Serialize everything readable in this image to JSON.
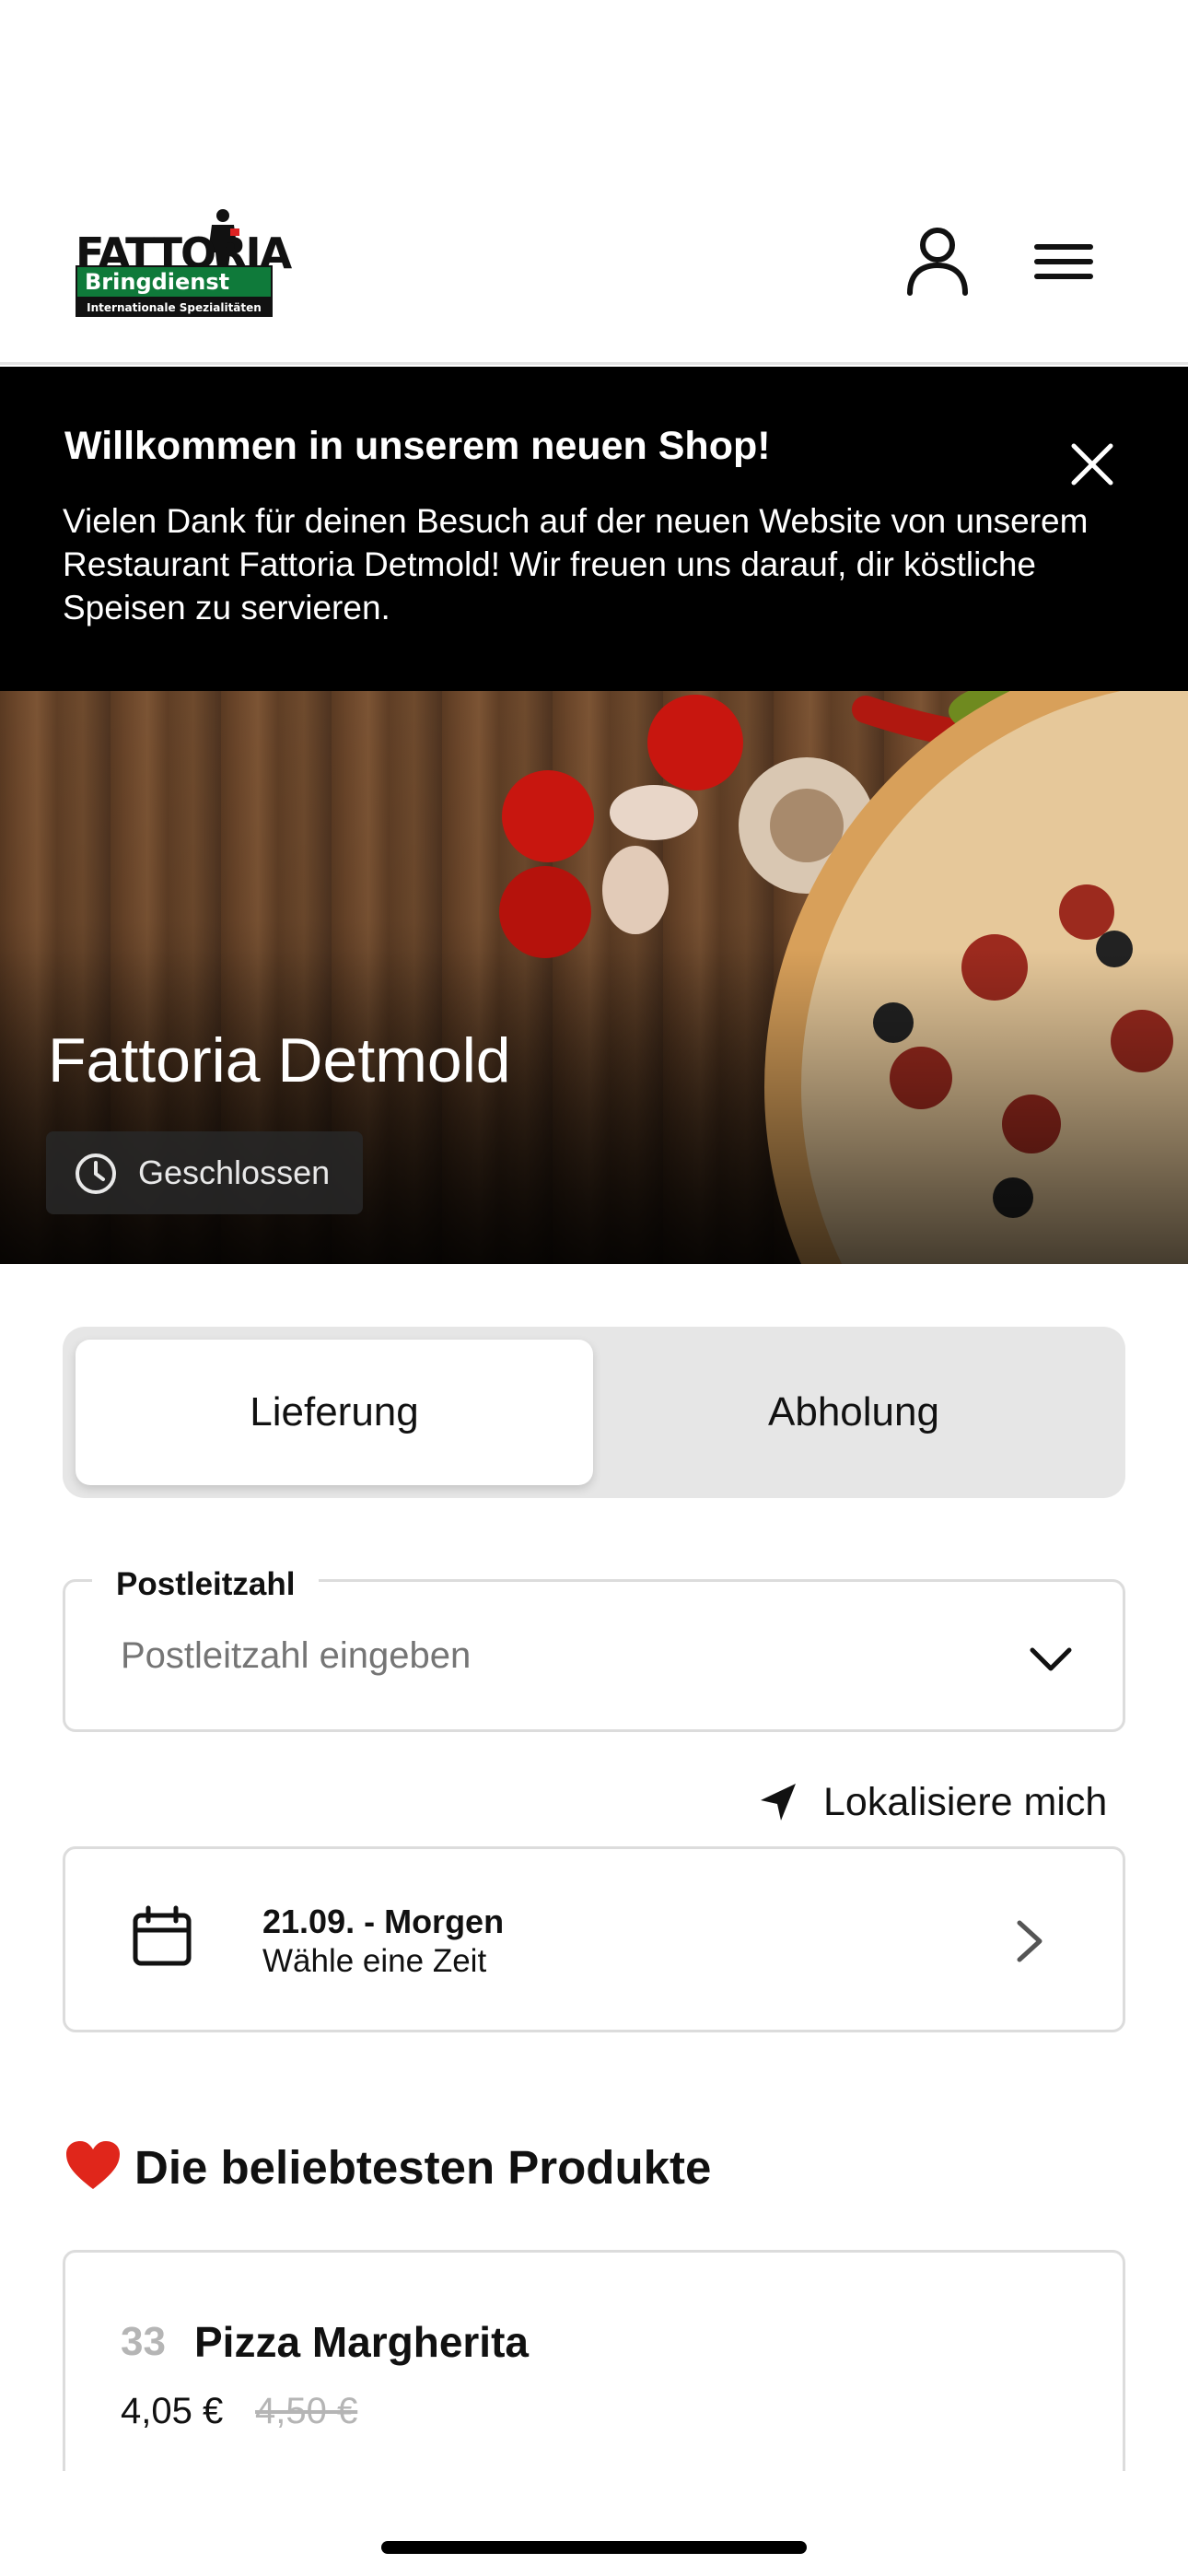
{
  "header": {
    "logo_text": "FATTORIA",
    "logo_band": "Bringdienst",
    "logo_tagline": "Internationale Spezialitäten",
    "user_icon": "user-icon",
    "menu_icon": "hamburger-menu-icon"
  },
  "banner": {
    "title": "Willkommen in unserem neuen Shop!",
    "text": "Vielen Dank für deinen Besuch auf der neuen Website von unserem Restaurant Fattoria Detmold! Wir freuen uns darauf, dir köstliche Speisen zu servieren.",
    "close_icon": "close-icon"
  },
  "hero": {
    "restaurant_name": "Fattoria Detmold",
    "status": "Geschlossen",
    "status_icon": "clock-icon"
  },
  "order_type": {
    "tabs": [
      {
        "label": "Lieferung",
        "active": true
      },
      {
        "label": "Abholung",
        "active": false
      }
    ]
  },
  "postal": {
    "label": "Postleitzahl",
    "placeholder": "Postleitzahl eingeben",
    "value": ""
  },
  "locate": {
    "label": "Lokalisiere mich",
    "icon": "location-arrow-icon"
  },
  "date": {
    "date_label": "21.09. - Morgen",
    "hint": "Wähle eine Zeit",
    "icon": "calendar-icon"
  },
  "popular": {
    "title": "Die beliebtesten Produkte",
    "products": [
      {
        "number": "33",
        "name": "Pizza Margherita",
        "price": "4,05 €",
        "old_price": "4,50 €"
      }
    ]
  },
  "colors": {
    "banner_bg": "#000000",
    "logo_green": "#0f7a3a",
    "tab_bg": "#e6e6e6",
    "border": "#dcdcdc",
    "heart": "#e0261b"
  }
}
